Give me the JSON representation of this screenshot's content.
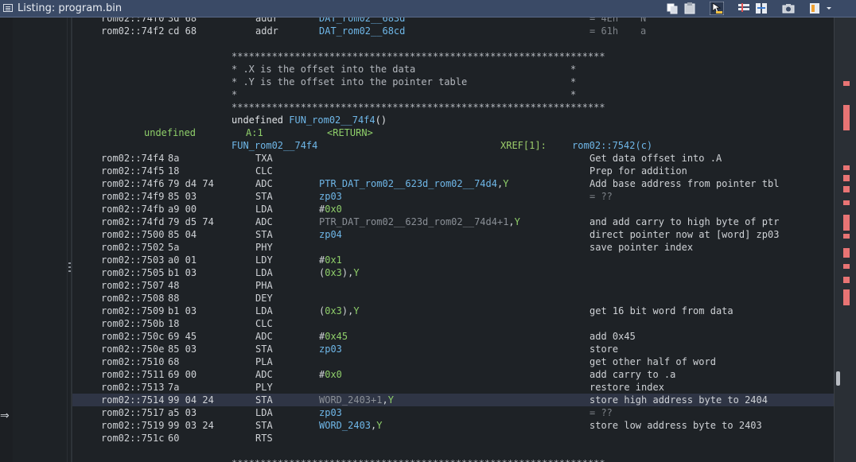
{
  "window": {
    "title": "Listing:  program.bin"
  },
  "toolbar": {
    "buttons": [
      "copy-icon",
      "paste-icon",
      "cursor-highlight-icon",
      "edit-fields-icon",
      "diff-icon",
      "snapshot-icon",
      "display-options-icon",
      "menu-dropdown-icon"
    ]
  },
  "listing": {
    "top_row": {
      "addr": "rom02::74f0",
      "bytes": "3d 68",
      "mnemonic": "addr",
      "operand": "DAT_rom02__683d",
      "hint": "= 4Eh",
      "hint_char": "N"
    },
    "rows_before": [
      {
        "addr": "rom02::74f2",
        "bytes": "cd 68",
        "mnemonic": "addr",
        "operand": "DAT_rom02__68cd",
        "hint": "= 61h",
        "hint_char": "a"
      }
    ],
    "comment_block": {
      "border": "*****************************************************************",
      "lines": [
        {
          "text": "* .X is the offset into the data",
          "end": "*"
        },
        {
          "text": "* .Y is the offset into the pointer table",
          "end": "*"
        },
        {
          "text": "*",
          "end": "*"
        }
      ]
    },
    "function": {
      "sig_prefix": "undefined ",
      "sig_name": "FUN_rom02__74f4",
      "sig_suffix": "()",
      "return_type": "undefined",
      "return_loc": "A:1",
      "return_name": "<RETURN>",
      "label": "FUN_rom02__74f4",
      "xref_label": "XREF[1]:",
      "xref_target": "rom02::7542(c)"
    },
    "rows": [
      {
        "addr": "rom02::74f4",
        "bytes": "8a",
        "mnemonic": "TXA",
        "op_parts": [],
        "comment": "Get data offset into .A"
      },
      {
        "addr": "rom02::74f5",
        "bytes": "18",
        "mnemonic": "CLC",
        "op_parts": [],
        "comment": "Prep for addition"
      },
      {
        "addr": "rom02::74f6",
        "bytes": "79 d4 74",
        "mnemonic": "ADC",
        "op_parts": [
          {
            "t": "PTR_DAT_rom02__623d_rom02__74d4",
            "c": "blue"
          },
          {
            "t": ",",
            "c": ""
          },
          {
            "t": "Y",
            "c": "green"
          }
        ],
        "comment": "Add base address from pointer tbl"
      },
      {
        "addr": "rom02::74f9",
        "bytes": "85 03",
        "mnemonic": "STA",
        "op_parts": [
          {
            "t": "zp03",
            "c": "blue"
          }
        ],
        "hint": "= ??"
      },
      {
        "addr": "rom02::74fb",
        "bytes": "a9 00",
        "mnemonic": "LDA",
        "op_parts": [
          {
            "t": "#",
            "c": ""
          },
          {
            "t": "0x0",
            "c": "green"
          }
        ]
      },
      {
        "addr": "rom02::74fd",
        "bytes": "79 d5 74",
        "mnemonic": "ADC",
        "op_parts": [
          {
            "t": "PTR_DAT_rom02__623d_rom02__74d4+1",
            "c": "dim"
          },
          {
            "t": ",",
            "c": ""
          },
          {
            "t": "Y",
            "c": "green"
          }
        ],
        "comment": "and add carry to high byte of ptr"
      },
      {
        "addr": "rom02::7500",
        "bytes": "85 04",
        "mnemonic": "STA",
        "op_parts": [
          {
            "t": "zp04",
            "c": "blue"
          }
        ],
        "comment": "direct pointer now at [word] zp03"
      },
      {
        "addr": "rom02::7502",
        "bytes": "5a",
        "mnemonic": "PHY",
        "op_parts": [],
        "comment": "save pointer index"
      },
      {
        "addr": "rom02::7503",
        "bytes": "a0 01",
        "mnemonic": "LDY",
        "op_parts": [
          {
            "t": "#",
            "c": ""
          },
          {
            "t": "0x1",
            "c": "green"
          }
        ]
      },
      {
        "addr": "rom02::7505",
        "bytes": "b1 03",
        "mnemonic": "LDA",
        "op_parts": [
          {
            "t": "(",
            "c": ""
          },
          {
            "t": "0x3",
            "c": "green"
          },
          {
            "t": "),",
            "c": ""
          },
          {
            "t": "Y",
            "c": "green"
          }
        ]
      },
      {
        "addr": "rom02::7507",
        "bytes": "48",
        "mnemonic": "PHA",
        "op_parts": []
      },
      {
        "addr": "rom02::7508",
        "bytes": "88",
        "mnemonic": "DEY",
        "op_parts": []
      },
      {
        "addr": "rom02::7509",
        "bytes": "b1 03",
        "mnemonic": "LDA",
        "op_parts": [
          {
            "t": "(",
            "c": ""
          },
          {
            "t": "0x3",
            "c": "green"
          },
          {
            "t": "),",
            "c": ""
          },
          {
            "t": "Y",
            "c": "green"
          }
        ],
        "comment": "get 16 bit word from data"
      },
      {
        "addr": "rom02::750b",
        "bytes": "18",
        "mnemonic": "CLC",
        "op_parts": []
      },
      {
        "addr": "rom02::750c",
        "bytes": "69 45",
        "mnemonic": "ADC",
        "op_parts": [
          {
            "t": "#",
            "c": ""
          },
          {
            "t": "0x45",
            "c": "green"
          }
        ],
        "comment": "add 0x45"
      },
      {
        "addr": "rom02::750e",
        "bytes": "85 03",
        "mnemonic": "STA",
        "op_parts": [
          {
            "t": "zp03",
            "c": "blue"
          }
        ],
        "comment": "store"
      },
      {
        "addr": "rom02::7510",
        "bytes": "68",
        "mnemonic": "PLA",
        "op_parts": [],
        "comment": "get other half of word"
      },
      {
        "addr": "rom02::7511",
        "bytes": "69 00",
        "mnemonic": "ADC",
        "op_parts": [
          {
            "t": "#",
            "c": ""
          },
          {
            "t": "0x0",
            "c": "green"
          }
        ],
        "comment": "add carry to .a"
      },
      {
        "addr": "rom02::7513",
        "bytes": "7a",
        "mnemonic": "PLY",
        "op_parts": [],
        "comment": "restore index"
      },
      {
        "addr": "rom02::7514",
        "bytes": "99 04 24",
        "mnemonic": "STA",
        "op_parts": [
          {
            "t": "WORD_2403+1",
            "c": "dim"
          },
          {
            "t": ",",
            "c": ""
          },
          {
            "t": "Y",
            "c": "green"
          }
        ],
        "comment": "store high address byte to 2404",
        "selected": true
      },
      {
        "addr": "rom02::7517",
        "bytes": "a5 03",
        "mnemonic": "LDA",
        "op_parts": [
          {
            "t": "zp03",
            "c": "blue"
          }
        ],
        "hint": "= ??"
      },
      {
        "addr": "rom02::7519",
        "bytes": "99 03 24",
        "mnemonic": "STA",
        "op_parts": [
          {
            "t": "WORD_2403",
            "c": "blue"
          },
          {
            "t": ",",
            "c": ""
          },
          {
            "t": "Y",
            "c": "green"
          }
        ],
        "comment": "store low address byte to 2403"
      },
      {
        "addr": "rom02::751c",
        "bytes": "60",
        "mnemonic": "RTS",
        "op_parts": []
      }
    ],
    "bottom_border": "*****************************************************************"
  },
  "overview": {
    "marker_color": "#e87474"
  },
  "left_strip": {
    "arrow": "⇒"
  }
}
